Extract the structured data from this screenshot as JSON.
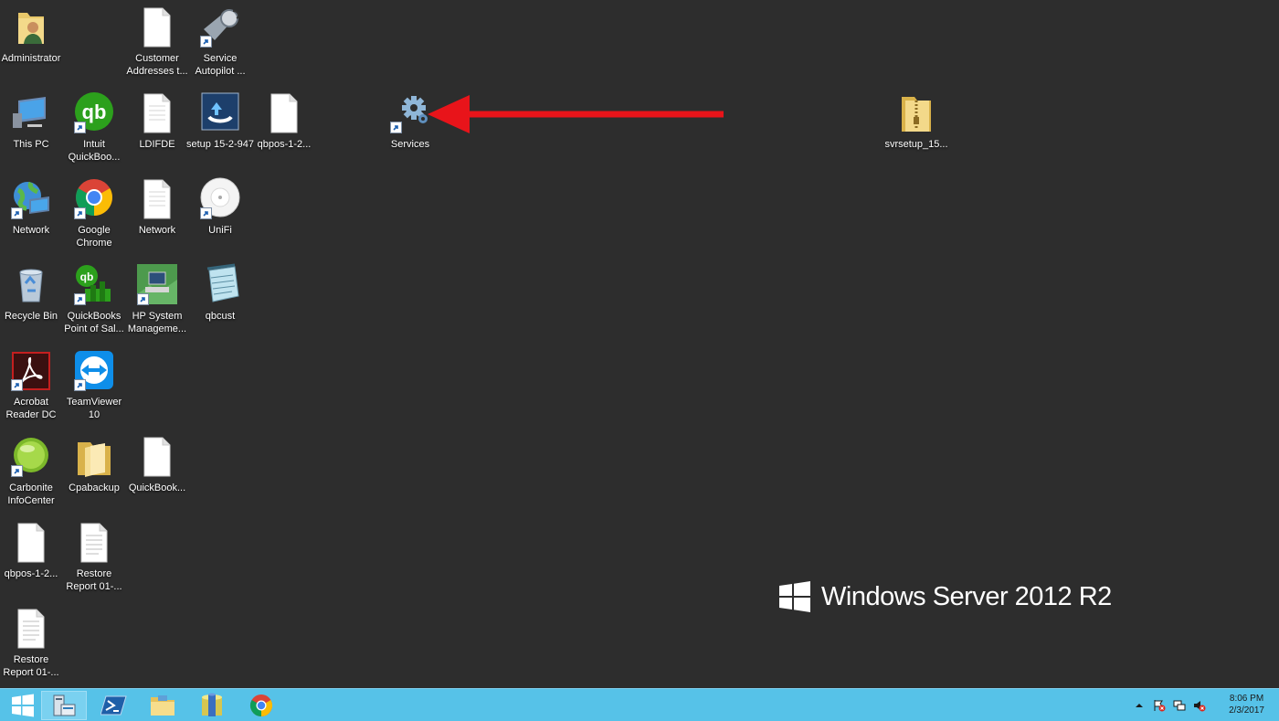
{
  "desktop": {
    "icons": [
      {
        "label": "Administrator",
        "icon": "user-folder-icon"
      },
      {
        "label": "Customer Addresses t...",
        "icon": "document-icon"
      },
      {
        "label": "Service Autopilot ...",
        "icon": "service-autopilot-icon"
      },
      {
        "label": "This PC",
        "icon": "this-pc-icon"
      },
      {
        "label": "Intuit QuickBoo...",
        "icon": "quickbooks-icon"
      },
      {
        "label": "LDIFDE",
        "icon": "document-icon"
      },
      {
        "label": "setup 15-2-947",
        "icon": "setup-icon"
      },
      {
        "label": "qbpos-1-2...",
        "icon": "document-icon"
      },
      {
        "label": "Services",
        "icon": "services-gear-icon"
      },
      {
        "label": "svrsetup_15...",
        "icon": "zip-folder-icon"
      },
      {
        "label": "Network",
        "icon": "network-icon"
      },
      {
        "label": "Google Chrome",
        "icon": "chrome-icon"
      },
      {
        "label": "Network",
        "icon": "document-icon"
      },
      {
        "label": "UniFi",
        "icon": "unifi-icon"
      },
      {
        "label": "Recycle Bin",
        "icon": "recycle-bin-icon"
      },
      {
        "label": "QuickBooks Point of Sal...",
        "icon": "quickbooks-pos-icon"
      },
      {
        "label": "HP System Manageme...",
        "icon": "hp-system-management-icon"
      },
      {
        "label": "qbcust",
        "icon": "notepad-icon"
      },
      {
        "label": "Acrobat Reader DC",
        "icon": "acrobat-icon"
      },
      {
        "label": "TeamViewer 10",
        "icon": "teamviewer-icon"
      },
      {
        "label": "Carbonite InfoCenter",
        "icon": "carbonite-icon"
      },
      {
        "label": "Cpabackup",
        "icon": "folder-icon"
      },
      {
        "label": "QuickBook...",
        "icon": "document-icon"
      },
      {
        "label": "qbpos-1-2...",
        "icon": "document-icon"
      },
      {
        "label": "Restore Report 01-...",
        "icon": "document-icon"
      },
      {
        "label": "Restore Report 01-...",
        "icon": "document-icon"
      }
    ]
  },
  "branding": {
    "text": "Windows Server 2012 R2"
  },
  "annotation": {
    "color": "#e8141a"
  },
  "taskbar": {
    "items": [
      "start-icon",
      "server-manager-icon",
      "powershell-icon",
      "file-explorer-icon",
      "database-icon",
      "chrome-icon"
    ],
    "clock": {
      "time": "8:06 PM",
      "date": "2/3/2017"
    }
  },
  "colors": {
    "desktop": "#2d2d2d",
    "taskbar": "#56c2e8"
  }
}
